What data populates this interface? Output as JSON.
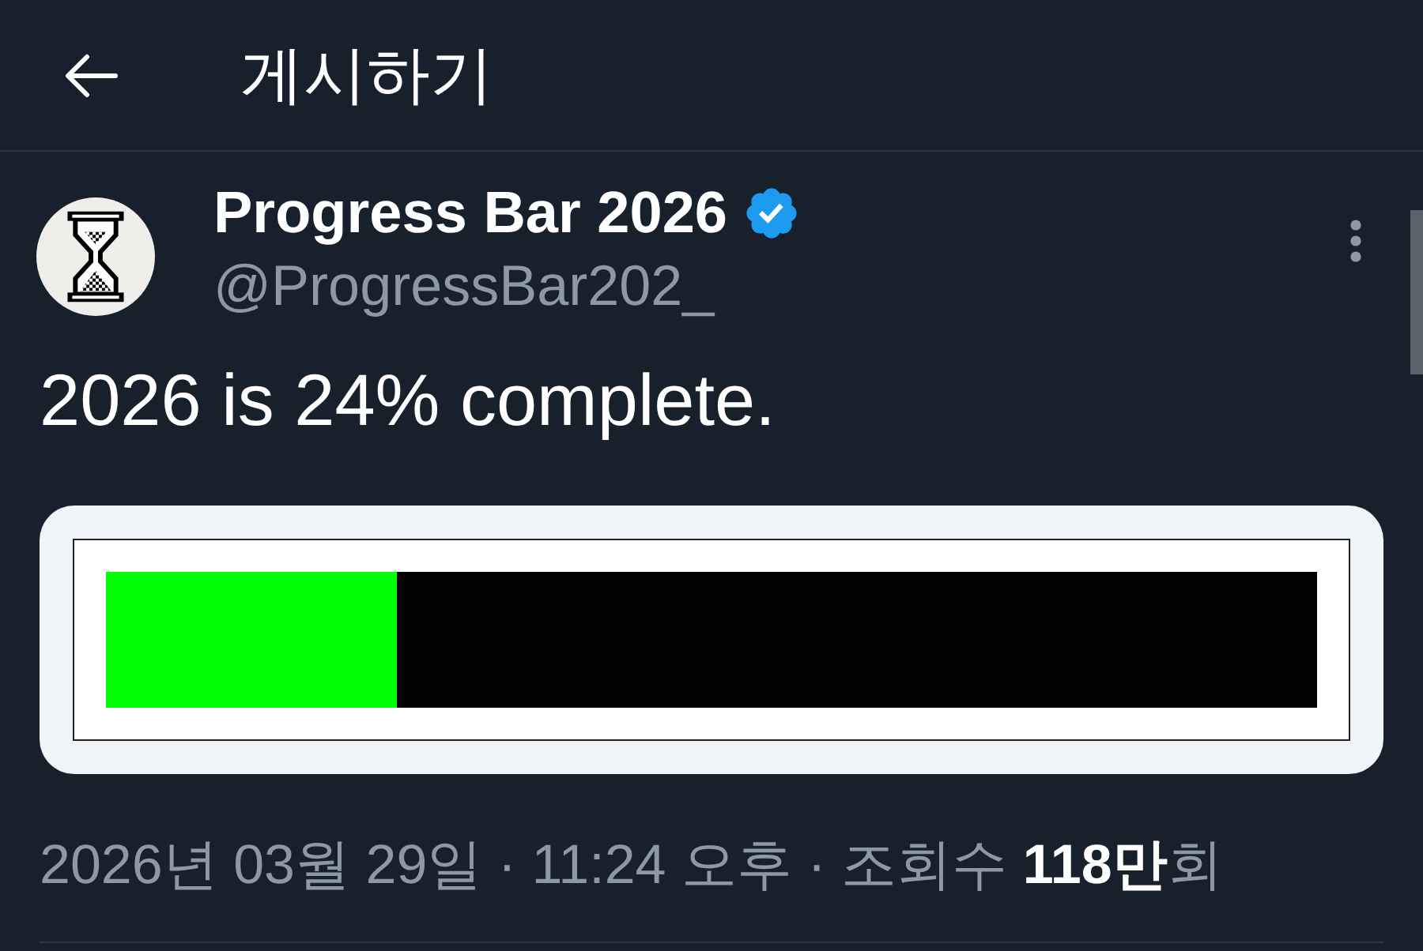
{
  "header": {
    "title": "게시하기"
  },
  "post": {
    "author": {
      "name": "Progress Bar 2026",
      "verified": true,
      "handle": "@ProgressBar202_"
    },
    "text": "2026 is 24% complete.",
    "media": {
      "progress_bar": {
        "level": 0.24
      }
    },
    "meta": "2026년 03월 29일 · 11:24 오후 · 조회수 **118만**회"
  }
}
